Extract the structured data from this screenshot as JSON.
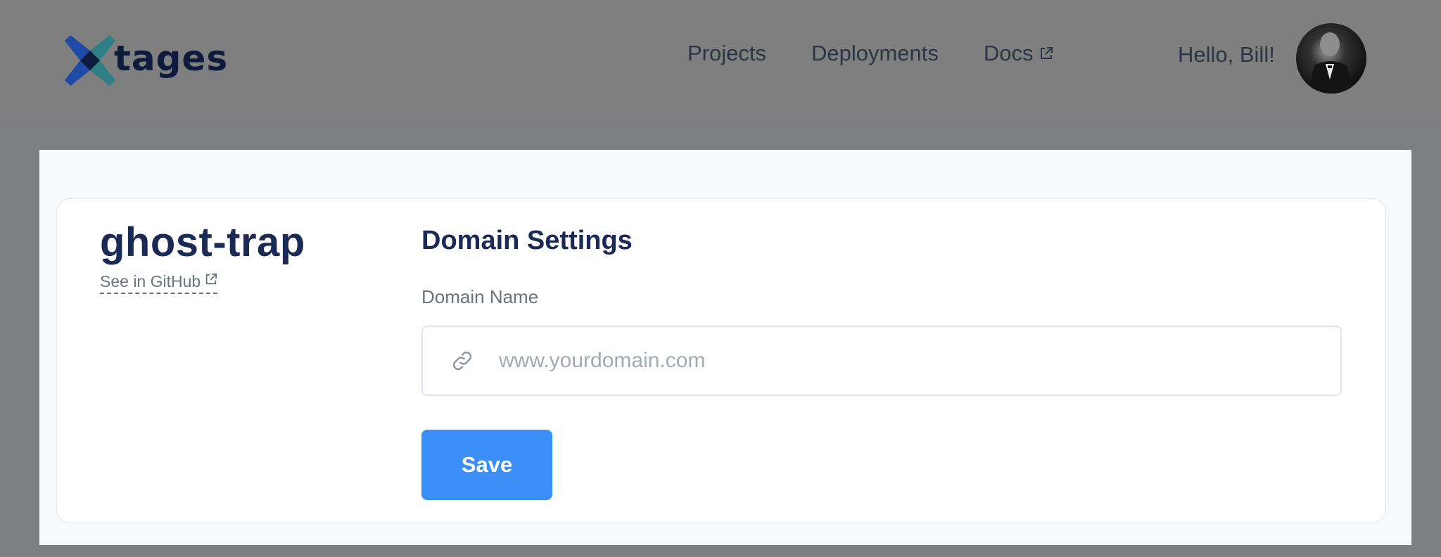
{
  "header": {
    "logo_text": "tages",
    "nav": [
      {
        "label": "Projects"
      },
      {
        "label": "Deployments"
      },
      {
        "label": "Docs"
      }
    ],
    "greeting": "Hello, Bill!"
  },
  "project": {
    "name": "ghost-trap",
    "github_link": "See in GitHub"
  },
  "domain_settings": {
    "title": "Domain Settings",
    "field_label": "Domain Name",
    "placeholder": "www.yourdomain.com",
    "value": "",
    "save_label": "Save"
  },
  "colors": {
    "accent": "#3a8ef6",
    "heading": "#1b2a55",
    "logo_dark": "#0e1b3d",
    "logo_blue": "#1f4aa8",
    "logo_teal": "#2f7f86"
  },
  "icons": {
    "external": "external-link-icon",
    "link": "link-icon"
  }
}
